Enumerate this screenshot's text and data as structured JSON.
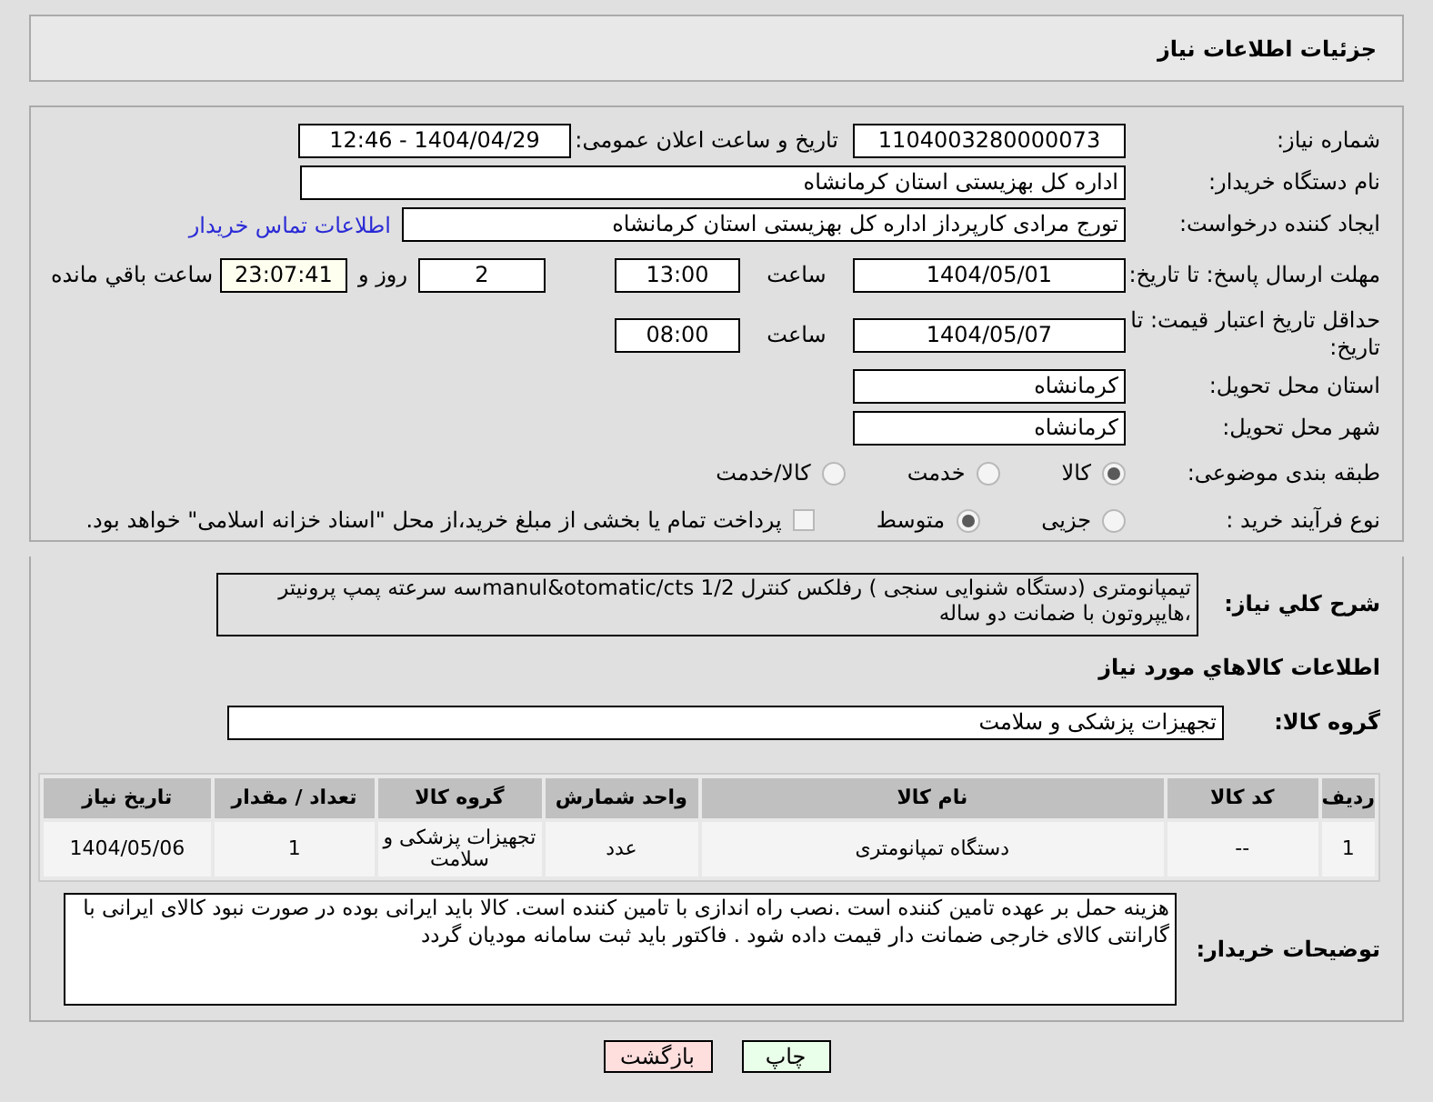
{
  "header": {
    "title": "جزئیات اطلاعات نیاز"
  },
  "need_number": {
    "label": "شماره نیاز:",
    "value": "1104003280000073"
  },
  "announce": {
    "label": "تاریخ و ساعت اعلان عمومی:",
    "value": "1404/04/29 - 12:46"
  },
  "buyer_org": {
    "label": "نام دستگاه خریدار:",
    "value": "اداره کل بهزیستی استان کرمانشاه"
  },
  "creator": {
    "label": "ایجاد کننده درخواست:",
    "value": "تورج مرادی کارپرداز  اداره کل بهزیستی استان کرمانشاه",
    "link": "اطلاعات تماس خریدار"
  },
  "deadline": {
    "label": "مهلت ارسال پاسخ: تا تاریخ:",
    "date": "1404/05/01",
    "time_label": "ساعت",
    "time": "13:00",
    "days": "2",
    "days_label": "روز و",
    "remaining": "23:07:41",
    "remaining_label": "ساعت باقي مانده"
  },
  "validity": {
    "label": "حداقل تاریخ اعتبار قیمت: تا تاریخ:",
    "date": "1404/05/07",
    "time_label": "ساعت",
    "time": "08:00"
  },
  "province": {
    "label": "استان محل تحویل:",
    "value": "کرمانشاه"
  },
  "city": {
    "label": "شهر محل تحویل:",
    "value": "کرمانشاه"
  },
  "category": {
    "label": "طبقه بندی موضوعی:",
    "options": [
      {
        "label": "کالا",
        "selected": true
      },
      {
        "label": "خدمت",
        "selected": false
      },
      {
        "label": "کالا/خدمت",
        "selected": false
      }
    ]
  },
  "process": {
    "label": "نوع فرآیند خرید :",
    "options": [
      {
        "label": "جزیی",
        "selected": false
      },
      {
        "label": "متوسط",
        "selected": true
      }
    ],
    "payment": {
      "label": "پرداخت تمام یا بخشی از مبلغ خرید،از محل \"اسناد خزانه اسلامی\" خواهد بود.",
      "checked": false
    }
  },
  "description": {
    "label": "شرح کلي نیاز:",
    "value": "تیمپانومتری (دستگاه شنوایی سنجی ) رفلکس کنترل 1/2 manul&otomatic/ctsسه سرعته  پمپ پرونیتر ،هایپروتون با ضمانت دو ساله"
  },
  "goods_heading": "اطلاعات کالاهاي مورد نیاز",
  "goods_group": {
    "label": "گروه کالا:",
    "value": "تجهیزات پزشکی و سلامت"
  },
  "table": {
    "columns": [
      "ردیف",
      "کد کالا",
      "نام کالا",
      "واحد شمارش",
      "گروه کالا",
      "تعداد / مقدار",
      "تاریخ نیاز"
    ],
    "rows": [
      [
        "1",
        "--",
        "دستگاه تمپانومتری",
        "عدد",
        "تجهیزات پزشکی و سلامت",
        "1",
        "1404/05/06"
      ]
    ]
  },
  "notes": {
    "label": "توضیحات خریدار:",
    "value": "هزینه حمل بر عهده تامین کننده است .نصب راه اندازی با تامین کننده است. کالا باید ایرانی بوده در صورت نبود کالای ایرانی با گارانتی  کالای خارجی ضمانت دار قیمت داده شود . فاکتور باید ثبت سامانه مودیان گردد"
  },
  "buttons": [
    {
      "label": "چاپ",
      "kind": "print"
    },
    {
      "label": "بازگشت",
      "kind": "back"
    }
  ]
}
